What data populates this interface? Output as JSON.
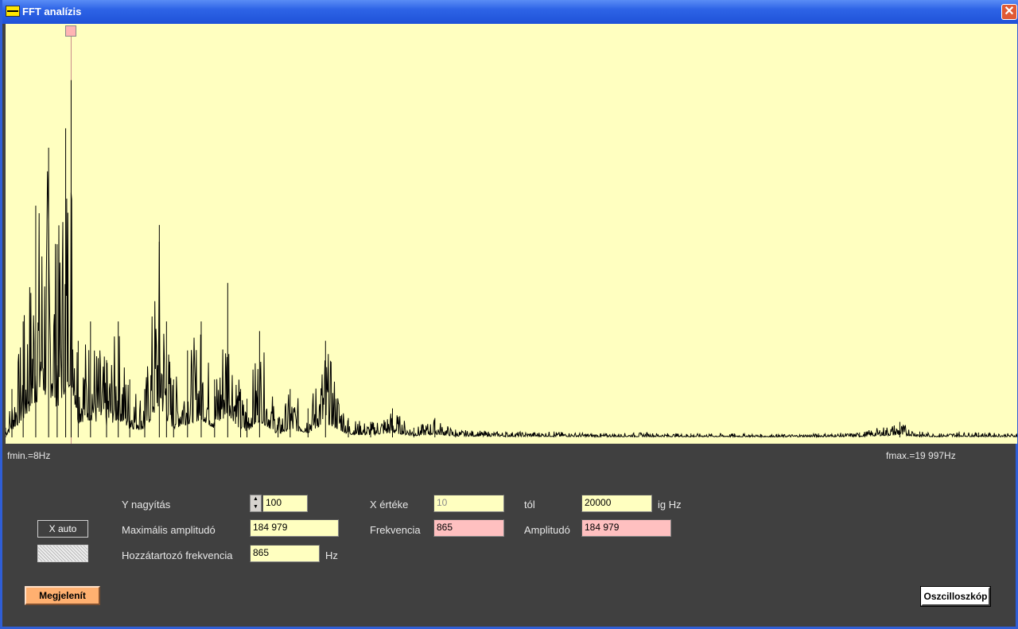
{
  "window": {
    "title": "FFT analízis",
    "close_label": "✕"
  },
  "plot": {
    "fmin_label": "fmin.=8Hz",
    "fmax_label": "fmax.=19 997Hz",
    "background": "#ffffc0",
    "trace_color": "#000000",
    "cursor_color": "#c98a8a"
  },
  "chart_data": {
    "type": "line",
    "title": "",
    "xlabel": "",
    "ylabel": "",
    "xlim": [
      8,
      19997
    ],
    "ylim": [
      0,
      210000
    ],
    "cursor_frequency": 865,
    "peak": {
      "x": 865,
      "y": 184979
    },
    "series": [
      {
        "x": [
          8,
          150,
          300,
          450,
          600,
          700,
          800,
          865,
          950,
          1100,
          1300,
          1450,
          1600,
          1800,
          2000,
          2100,
          2200,
          2400,
          2600,
          2800,
          3000,
          3200,
          3300,
          3500,
          3800,
          4000,
          4300,
          4600,
          5000,
          5400,
          5800,
          6200,
          6600,
          7000,
          8000,
          9000,
          10000,
          11000,
          12000,
          13000,
          14000,
          15000,
          16000,
          17000,
          17500,
          18000,
          18500,
          19000,
          19997
        ],
        "y": [
          5000,
          25000,
          60000,
          120000,
          150000,
          100000,
          160000,
          184979,
          50000,
          60000,
          40000,
          60000,
          30000,
          25000,
          110000,
          60000,
          30000,
          45000,
          60000,
          30000,
          80000,
          25000,
          20000,
          55000,
          10000,
          25000,
          15000,
          50000,
          10000,
          8000,
          15000,
          5000,
          10000,
          4000,
          3000,
          3000,
          2000,
          2500,
          2000,
          2000,
          1500,
          2000,
          2500,
          8000,
          3000,
          2000,
          3000,
          2500,
          2000
        ]
      }
    ]
  },
  "controls": {
    "x_auto_label": "X auto",
    "y_zoom_label": "Y nagyítás",
    "y_zoom_value": "100",
    "max_amp_label": "Maximális amplitudó",
    "max_amp_value": "184 979",
    "assoc_freq_label": "Hozzátartozó frekvencia",
    "assoc_freq_value": "865",
    "hz_unit": "Hz",
    "x_value_label": "X értéke",
    "x_value": "10",
    "from_label": "tól",
    "from_value": "20000",
    "to_unit_label": "ig Hz",
    "freq_label": "Frekvencia",
    "freq_value": "865",
    "amp_label": "Amplitudó",
    "amp_value": "184 979",
    "show_button": "Megjelenít",
    "osc_button": "Oszcilloszkóp"
  }
}
